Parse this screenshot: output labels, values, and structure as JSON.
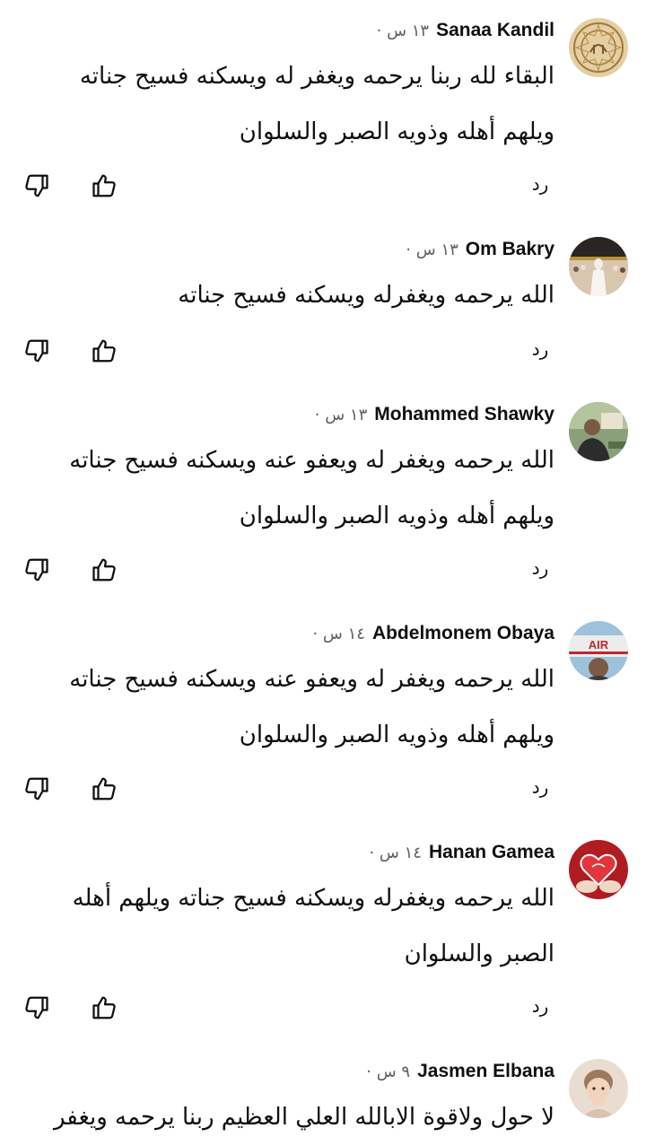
{
  "comments": [
    {
      "author": "Sanaa Kandil",
      "meta": "١٣ س ·",
      "text": "البقاء لله ربنا يرحمه ويغفر له ويسكنه فسيح جناته\nويلهم أهله وذويه الصبر والسلوان",
      "reply_label": "رد"
    },
    {
      "author": "Om Bakry",
      "meta": "١٣ س ·",
      "text": "الله يرحمه ويغفرله ويسكنه فسيح جناته",
      "reply_label": "رد"
    },
    {
      "author": "Mohammed Shawky",
      "meta": "١٣ س ·",
      "text": "الله يرحمه ويغفر له ويعفو عنه ويسكنه فسيح جناته\nويلهم أهله وذويه الصبر والسلوان",
      "reply_label": "رد"
    },
    {
      "author": "Abdelmonem Obaya",
      "meta": "١٤ س ·",
      "text": "الله يرحمه ويغفر له ويعفو عنه ويسكنه فسيح جناته\nويلهم أهله وذويه الصبر والسلوان",
      "reply_label": "رد"
    },
    {
      "author": "Hanan Gamea",
      "meta": "١٤ س ·",
      "text": "الله يرحمه ويغفرله ويسكنه فسيح جناته ويلهم أهله\nالصبر والسلوان",
      "reply_label": "رد"
    },
    {
      "author": "Jasmen Elbana",
      "meta": "٩ س ·",
      "text": "لا حول ولاقوة الابالله العلي العظيم ربنا يرحمه ويغفر",
      "reply_label": ""
    }
  ],
  "avatar_texts": {
    "airline_logo": "AIR"
  },
  "colors": {
    "text": "#0f0f0f",
    "secondary": "#606060",
    "background": "#ffffff"
  }
}
